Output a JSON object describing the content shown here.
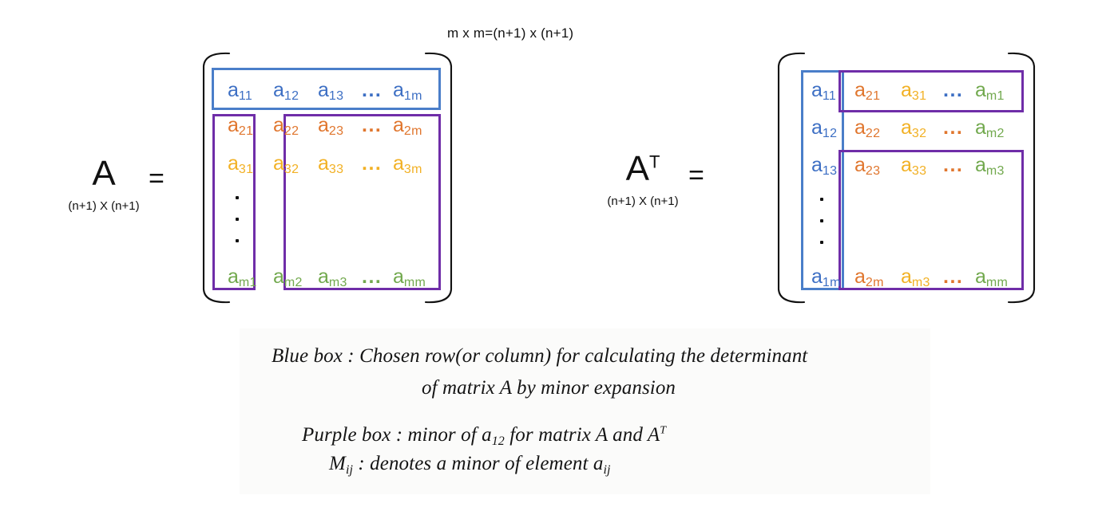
{
  "top_dimension_label": "m x m=(n+1) x (n+1)",
  "matrices": [
    {
      "name": "A",
      "superscript": "",
      "dims": "(n+1) X (n+1)",
      "equals": "=",
      "rows": [
        {
          "color": "blue",
          "cells": [
            "a11",
            "a12",
            "a13",
            "...",
            "a1m"
          ]
        },
        {
          "color": "orange",
          "cells": [
            "a21",
            "a22",
            "a23",
            "...",
            "a2m"
          ]
        },
        {
          "color": "gold",
          "cells": [
            "a31",
            "a32",
            "a33",
            "...",
            "a3m"
          ]
        },
        {
          "color": "green",
          "cells": [
            "am1",
            "am2",
            "am3",
            "...",
            "amm"
          ]
        }
      ],
      "vertical_ellipsis": "."
    },
    {
      "name": "A",
      "superscript": "T",
      "dims": "(n+1) X (n+1)",
      "equals": "=",
      "rows": [
        {
          "cells": [
            "a11",
            "a21",
            "a31",
            "...",
            "am1"
          ]
        },
        {
          "cells": [
            "a12",
            "a22",
            "a32",
            "...",
            "am2"
          ]
        },
        {
          "cells": [
            "a13",
            "a23",
            "a33",
            "...",
            "am3"
          ]
        },
        {
          "cells": [
            "a1m",
            "a2m",
            "am3",
            "...",
            "amm"
          ]
        }
      ],
      "vertical_ellipsis": "."
    }
  ],
  "cells": {
    "A": {
      "r1": {
        "c1": {
          "base": "a",
          "sub": "11"
        },
        "c2": {
          "base": "a",
          "sub": "12"
        },
        "c3": {
          "base": "a",
          "sub": "13"
        },
        "c4": {
          "base": "...",
          "sub": ""
        },
        "c5": {
          "base": "a",
          "sub": "1m"
        }
      },
      "r2": {
        "c1": {
          "base": "a",
          "sub": "21"
        },
        "c2": {
          "base": "a",
          "sub": "22"
        },
        "c3": {
          "base": "a",
          "sub": "23"
        },
        "c4": {
          "base": "...",
          "sub": ""
        },
        "c5": {
          "base": "a",
          "sub": "2m"
        }
      },
      "r3": {
        "c1": {
          "base": "a",
          "sub": "31"
        },
        "c2": {
          "base": "a",
          "sub": "32"
        },
        "c3": {
          "base": "a",
          "sub": "33"
        },
        "c4": {
          "base": "...",
          "sub": ""
        },
        "c5": {
          "base": "a",
          "sub": "3m"
        }
      },
      "r4": {
        "c1": {
          "base": "a",
          "sub": "m1"
        },
        "c2": {
          "base": "a",
          "sub": "m2"
        },
        "c3": {
          "base": "a",
          "sub": "m3"
        },
        "c4": {
          "base": "...",
          "sub": ""
        },
        "c5": {
          "base": "a",
          "sub": "mm"
        }
      }
    },
    "AT": {
      "r1": {
        "c1": {
          "base": "a",
          "sub": "11"
        },
        "c2": {
          "base": "a",
          "sub": "21"
        },
        "c3": {
          "base": "a",
          "sub": "31"
        },
        "c4": {
          "base": "...",
          "sub": ""
        },
        "c5": {
          "base": "a",
          "sub": "m1"
        }
      },
      "r2": {
        "c1": {
          "base": "a",
          "sub": "12"
        },
        "c2": {
          "base": "a",
          "sub": "22"
        },
        "c3": {
          "base": "a",
          "sub": "32"
        },
        "c4": {
          "base": "...",
          "sub": ""
        },
        "c5": {
          "base": "a",
          "sub": "m2"
        }
      },
      "r3": {
        "c1": {
          "base": "a",
          "sub": "13"
        },
        "c2": {
          "base": "a",
          "sub": "23"
        },
        "c3": {
          "base": "a",
          "sub": "33"
        },
        "c4": {
          "base": "...",
          "sub": ""
        },
        "c5": {
          "base": "a",
          "sub": "m3"
        }
      },
      "r4": {
        "c1": {
          "base": "a",
          "sub": "1m"
        },
        "c2": {
          "base": "a",
          "sub": "2m"
        },
        "c3": {
          "base": "a",
          "sub": "m3"
        },
        "c4": {
          "base": "...",
          "sub": ""
        },
        "c5": {
          "base": "a",
          "sub": "mm"
        }
      }
    }
  },
  "legend": {
    "blue_box": {
      "line1_prefix": "Blue box :",
      "line1": "Blue box :  Chosen row(or column) for calculating the determinant",
      "line2": "of matrix A by minor expansion"
    },
    "purple_box": {
      "line1_a": "Purple box :  minor of a",
      "line1_sub": "12",
      "line1_b": " for matrix A and A",
      "line1_sup": "T"
    },
    "minor_notation": {
      "m_letter": "M",
      "m_sub": "ij",
      "text": " : denotes a minor of element a",
      "a_sub": "ij"
    }
  },
  "colors": {
    "blue": "#3d6fc4",
    "orange": "#e0762e",
    "gold": "#f2b125",
    "green": "#72a94e",
    "purple_box": "#6f2da8",
    "blue_box": "#4a7ec9",
    "bracket": "#111111",
    "squiggle": "#e03020"
  }
}
